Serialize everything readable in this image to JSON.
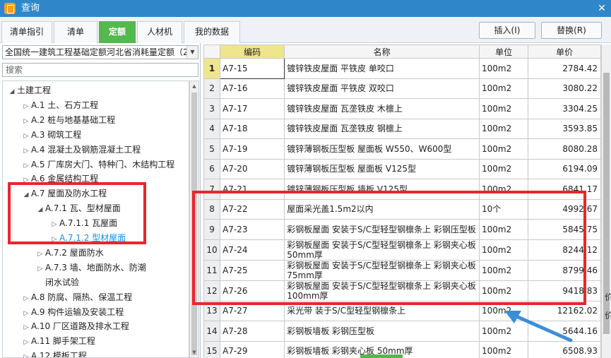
{
  "window": {
    "title": "查询",
    "close": "✕"
  },
  "tabs": [
    {
      "label": "清单指引",
      "active": false
    },
    {
      "label": "清单",
      "active": false
    },
    {
      "label": "定额",
      "active": true
    },
    {
      "label": "人材机",
      "active": false
    },
    {
      "label": "我的数据",
      "active": false
    }
  ],
  "toolbar": {
    "insert_label": "插入(I)",
    "replace_label": "替换(R)"
  },
  "library": {
    "selected": "全国统一建筑工程基础定额河北省消耗量定额（2"
  },
  "search": {
    "placeholder": "搜索"
  },
  "tree": [
    {
      "label": "土建工程",
      "level": 0,
      "arrow": "◢",
      "selected": false
    },
    {
      "label": "A.1 土、石方工程",
      "level": 1,
      "arrow": "▷",
      "selected": false
    },
    {
      "label": "A.2 桩与地基基础工程",
      "level": 1,
      "arrow": "▷",
      "selected": false
    },
    {
      "label": "A.3 砌筑工程",
      "level": 1,
      "arrow": "▷",
      "selected": false
    },
    {
      "label": "A.4 混凝土及钢筋混凝土工程",
      "level": 1,
      "arrow": "▷",
      "selected": false
    },
    {
      "label": "A.5 厂库房大门、特种门、木结构工程",
      "level": 1,
      "arrow": "▷",
      "selected": false
    },
    {
      "label": "A.6 金属结构工程",
      "level": 1,
      "arrow": "▷",
      "selected": false
    },
    {
      "label": "A.7 屋面及防水工程",
      "level": 1,
      "arrow": "◢",
      "selected": false
    },
    {
      "label": "A.7.1 瓦、型材屋面",
      "level": 2,
      "arrow": "◢",
      "selected": false
    },
    {
      "label": "A.7.1.1 瓦屋面",
      "level": 3,
      "arrow": "▷",
      "selected": false
    },
    {
      "label": "A.7.1.2 型材屋面",
      "level": 3,
      "arrow": "▷",
      "selected": true
    },
    {
      "label": "A.7.2 屋面防水",
      "level": 2,
      "arrow": "▷",
      "selected": false
    },
    {
      "label": "A.7.3 墙、地面防水、防潮",
      "level": 2,
      "arrow": "▷",
      "selected": false
    },
    {
      "label": "闭水试验",
      "level": 2,
      "arrow": "",
      "selected": false
    },
    {
      "label": "A.8 防腐、隔热、保温工程",
      "level": 1,
      "arrow": "▷",
      "selected": false
    },
    {
      "label": "A.9 构件运输及安装工程",
      "level": 1,
      "arrow": "▷",
      "selected": false
    },
    {
      "label": "A.10 厂区道路及排水工程",
      "level": 1,
      "arrow": "▷",
      "selected": false
    },
    {
      "label": "A.11 脚手架工程",
      "level": 1,
      "arrow": "▷",
      "selected": false
    },
    {
      "label": "A.12 模板工程",
      "level": 1,
      "arrow": "▷",
      "selected": false
    }
  ],
  "grid": {
    "columns": {
      "num": "",
      "code": "编码",
      "name": "名称",
      "unit": "单位",
      "price": "单价"
    },
    "rows": [
      {
        "num": "1",
        "code": "A7-15",
        "name": "镀锌铁皮屋面 平铁皮 单咬口",
        "unit": "100m2",
        "price": "2784.42"
      },
      {
        "num": "2",
        "code": "A7-16",
        "name": "镀锌铁皮屋面 平铁皮 双咬口",
        "unit": "100m2",
        "price": "3080.22"
      },
      {
        "num": "3",
        "code": "A7-17",
        "name": "镀锌铁皮屋面 瓦垄铁皮 木檩上",
        "unit": "100m2",
        "price": "3304.25"
      },
      {
        "num": "4",
        "code": "A7-18",
        "name": "镀锌铁皮屋面 瓦垄铁皮 钢檩上",
        "unit": "100m2",
        "price": "3593.85"
      },
      {
        "num": "5",
        "code": "A7-19",
        "name": "镀锌薄钢板压型板 屋面板 W550、W600型",
        "unit": "100m2",
        "price": "8080.28"
      },
      {
        "num": "6",
        "code": "A7-20",
        "name": "镀锌薄钢板压型板 屋面板 V125型",
        "unit": "100m2",
        "price": "6194.09"
      },
      {
        "num": "7",
        "code": "A7-21",
        "name": "镀锌薄钢板压型板 墙板 V125型",
        "unit": "100m2",
        "price": "6841.17"
      },
      {
        "num": "8",
        "code": "A7-22",
        "name": "屋面采光盖1.5m2以内",
        "unit": "10个",
        "price": "4992.67"
      },
      {
        "num": "9",
        "code": "A7-23",
        "name": "彩钢板屋面 安装于S/C型轻型钢檩条上 彩钢压型板",
        "unit": "100m2",
        "price": "5845.75"
      },
      {
        "num": "10",
        "code": "A7-24",
        "name": "彩钢板屋面 安装于S/C型轻型钢檩条上 彩钢夹心板 50mm厚",
        "unit": "100m2",
        "price": "8244.12"
      },
      {
        "num": "11",
        "code": "A7-25",
        "name": "彩钢板屋面 安装于S/C型轻型钢檩条上 彩钢夹心板 75mm厚",
        "unit": "100m2",
        "price": "8799.46"
      },
      {
        "num": "12",
        "code": "A7-26",
        "name": "彩钢板屋面 安装于S/C型轻型钢檩条上 彩钢夹心板 100mm厚",
        "unit": "100m2",
        "price": "9418.83"
      },
      {
        "num": "13",
        "code": "A7-27",
        "name": "采光带 装于S/C型轻型钢檩条上",
        "unit": "100m2",
        "price": "12162.02"
      },
      {
        "num": "14",
        "code": "A7-28",
        "name": "彩钢板墙板 彩钢压型板",
        "unit": "100m2",
        "price": "5644.16"
      },
      {
        "num": "15",
        "code": "A7-29",
        "name": "彩钢板墙板 彩钢夹心板 50mm厚",
        "unit": "100m2",
        "price": "6508.93"
      }
    ]
  },
  "edge_text": [
    "价",
    "价"
  ],
  "colors": {
    "accent_tab": "#53b84e",
    "titlebar": "#2f87c9",
    "annotation": "#e9262d",
    "arrow": "#3a8fd6"
  }
}
